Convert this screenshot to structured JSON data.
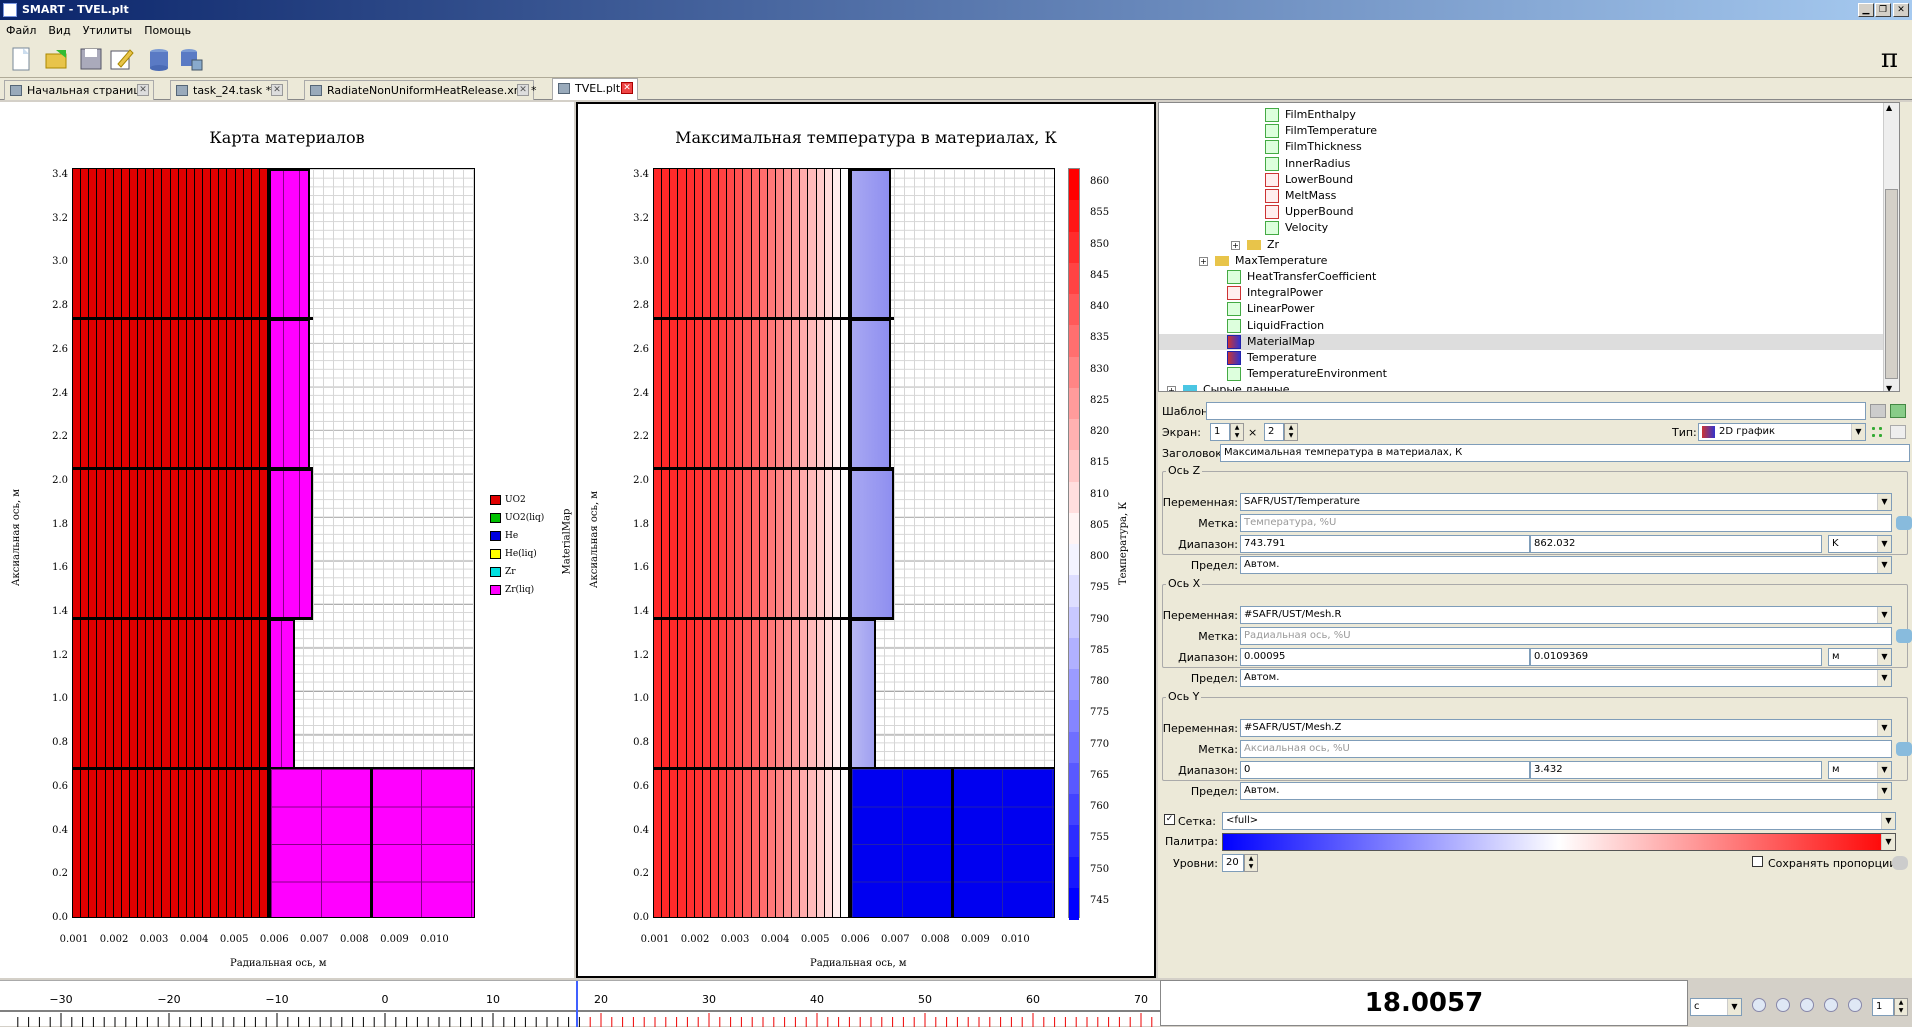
{
  "window": {
    "title": "SMART - TVEL.plt"
  },
  "menu": [
    "Файл",
    "Вид",
    "Утилиты",
    "Помощь"
  ],
  "toolbar": {
    "pi": "π"
  },
  "tabs": [
    {
      "label": "Начальная страница"
    },
    {
      "label": "task_24.task *"
    },
    {
      "label": "RadiateNonUniformHeatRelease.xml *"
    },
    {
      "label": "TVEL.plt"
    }
  ],
  "left_plot": {
    "title": "Карта материалов",
    "xlabel": "Радиальная ось, м",
    "ylabel": "Аксиальная ось, м",
    "rlabel": "MaterialMap",
    "legend": [
      {
        "name": "UO2",
        "color": "#e00000"
      },
      {
        "name": "UO2(liq)",
        "color": "#00c000"
      },
      {
        "name": "He",
        "color": "#0000e0"
      },
      {
        "name": "He(liq)",
        "color": "#ffff00"
      },
      {
        "name": "Zr",
        "color": "#00e0e0"
      },
      {
        "name": "Zr(liq)",
        "color": "#ff00ff"
      }
    ]
  },
  "right_plot": {
    "title": "Максимальная температура в материалах, К",
    "xlabel": "Радиальная ось, м",
    "ylabel": "Аксиальная ось, м",
    "rlabel": "Температура, К"
  },
  "chart_data": {
    "type": "heatmap",
    "yticks": [
      "3.4",
      "3.2",
      "3.0",
      "2.8",
      "2.6",
      "2.4",
      "2.2",
      "2.0",
      "1.8",
      "1.6",
      "1.4",
      "1.2",
      "1.0",
      "0.8",
      "0.6",
      "0.4",
      "0.2",
      "0.0"
    ],
    "xticks": [
      "0.001",
      "0.002",
      "0.003",
      "0.004",
      "0.005",
      "0.006",
      "0.007",
      "0.008",
      "0.009",
      "0.010"
    ],
    "colorbar": [
      "860",
      "855",
      "850",
      "845",
      "840",
      "835",
      "830",
      "825",
      "820",
      "815",
      "810",
      "805",
      "800",
      "795",
      "790",
      "785",
      "780",
      "775",
      "770",
      "765",
      "760",
      "755",
      "750",
      "745"
    ],
    "xlim": [
      0.00095,
      0.0109369
    ],
    "ylim": [
      0,
      3.432
    ],
    "zlim": [
      743.791,
      862.032
    ]
  },
  "tree": {
    "items": [
      {
        "label": "FilmEnthalpy",
        "icon": "green"
      },
      {
        "label": "FilmTemperature",
        "icon": "green"
      },
      {
        "label": "FilmThickness",
        "icon": "green"
      },
      {
        "label": "InnerRadius",
        "icon": "green"
      },
      {
        "label": "LowerBound",
        "icon": "red"
      },
      {
        "label": "MeltMass",
        "icon": "red"
      },
      {
        "label": "UpperBound",
        "icon": "red"
      },
      {
        "label": "Velocity",
        "icon": "green"
      },
      {
        "label": "Zr",
        "icon": "folder"
      },
      {
        "label": "MaxTemperature",
        "icon": "folder"
      },
      {
        "label": "HeatTransferCoefficient",
        "icon": "green"
      },
      {
        "label": "IntegralPower",
        "icon": "red"
      },
      {
        "label": "LinearPower",
        "icon": "green"
      },
      {
        "label": "LiquidFraction",
        "icon": "green"
      },
      {
        "label": "MaterialMap",
        "icon": "map"
      },
      {
        "label": "Temperature",
        "icon": "map"
      },
      {
        "label": "TemperatureEnvironment",
        "icon": "green"
      },
      {
        "label": "Сырые данные",
        "icon": "folder2"
      }
    ]
  },
  "props": {
    "template_label": "Шаблон:",
    "template_value": "",
    "screen_label": "Экран:",
    "screen_a": "1",
    "screen_x": "×",
    "screen_b": "2",
    "type_label": "Тип:",
    "type_value": "2D график",
    "header_label": "Заголовок:",
    "header_value": "Максимальная температура в материалах, К",
    "axis_z": {
      "title": "Ось Z",
      "var_label": "Переменная:",
      "var": "SAFR/UST/Temperature",
      "mark_label": "Метка:",
      "mark": "Температура, %U",
      "range_label": "Диапазон:",
      "min": "743.791",
      "max": "862.032",
      "unit": "K",
      "limit_label": "Предел:",
      "limit": "Автом."
    },
    "axis_x": {
      "title": "Ось X",
      "var_label": "Переменная:",
      "var": "#SAFR/UST/Mesh.R",
      "mark_label": "Метка:",
      "mark": "Радиальная ось, %U",
      "range_label": "Диапазон:",
      "min": "0.00095",
      "max": "0.0109369",
      "unit": "м",
      "limit_label": "Предел:",
      "limit": "Автом."
    },
    "axis_y": {
      "title": "Ось Y",
      "var_label": "Переменная:",
      "var": "#SAFR/UST/Mesh.Z",
      "mark_label": "Метка:",
      "mark": "Аксиальная ось, %U",
      "range_label": "Диапазон:",
      "min": "0",
      "max": "3.432",
      "unit": "м",
      "limit_label": "Предел:",
      "limit": "Автом."
    },
    "grid_label": "Сетка:",
    "grid_value": "<full>",
    "palette_label": "Палитра:",
    "levels_label": "Уровни:",
    "levels_value": "20",
    "keep_ratio_label": "Сохранять пропорции"
  },
  "timeline": {
    "ticks": [
      "−30",
      "−20",
      "−10",
      "0",
      "10",
      "20",
      "30",
      "40",
      "50",
      "60",
      "70"
    ],
    "readout": "18.0057",
    "unit": "с",
    "step": "1"
  }
}
